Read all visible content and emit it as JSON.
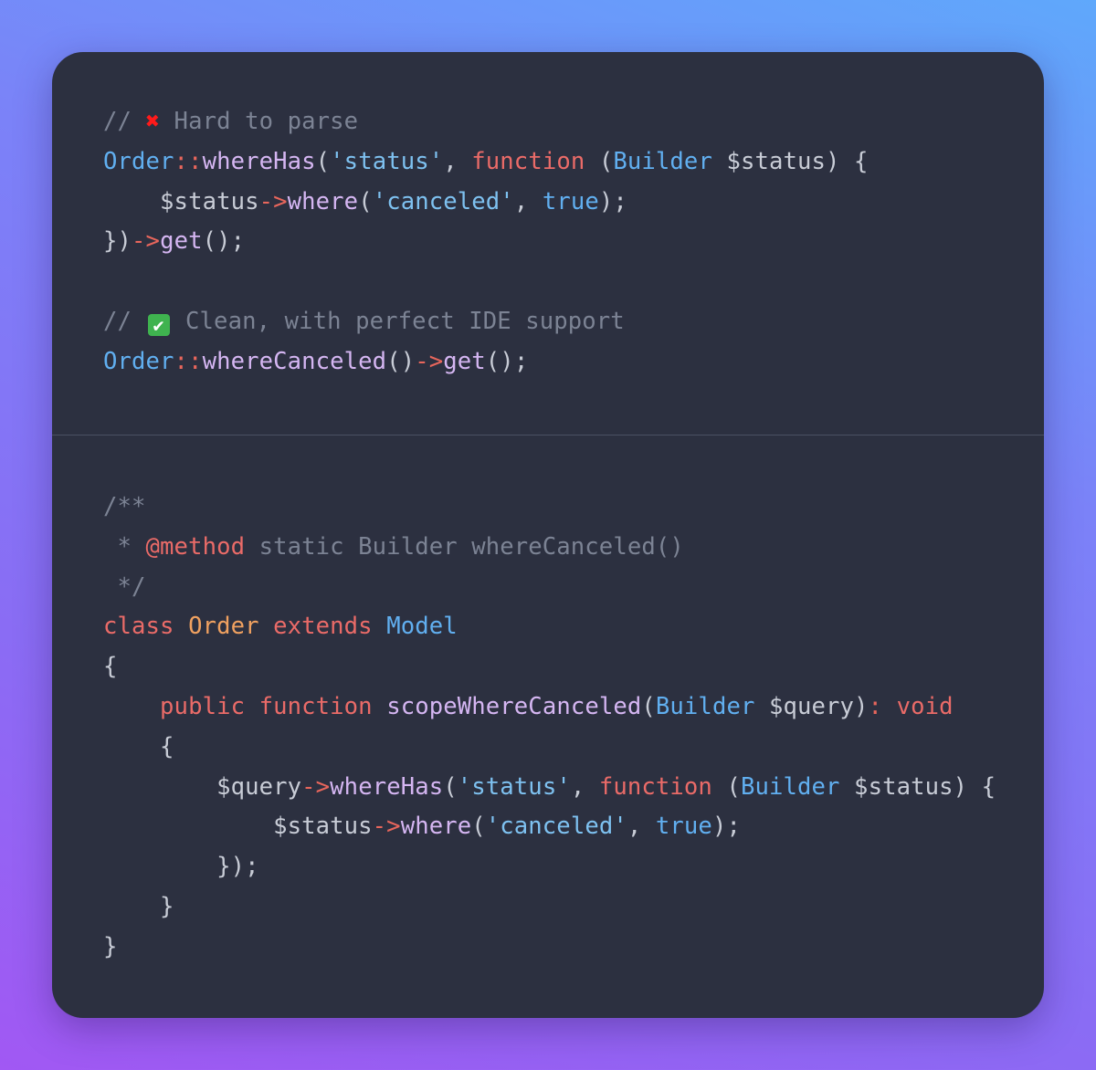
{
  "colors": {
    "card_background": "#2c3040",
    "comment": "#7c8394",
    "class_name": "#61aff0",
    "operator": "#e8665c",
    "method": "#d5b6f2",
    "string": "#7ec1f0",
    "keyword": "#ea6b68",
    "type_name": "#f0a160",
    "default_text": "#c8ccd6"
  },
  "top": {
    "comment_bad": {
      "prefix": "// ",
      "icon": "cross-mark-icon",
      "icon_glyph": "✖",
      "text": " Hard to parse"
    },
    "line1": {
      "class": "Order",
      "op": "::",
      "method": "whereHas",
      "open": "(",
      "arg1": "'status'",
      "comma": ", ",
      "kw": "function",
      "sp": " (",
      "type": "Builder",
      "var": " $status",
      "close": ") {"
    },
    "line2": {
      "indent": "    ",
      "var": "$status",
      "op": "->",
      "method": "where",
      "open": "(",
      "str": "'canceled'",
      "comma": ", ",
      "bool": "true",
      "close": ");"
    },
    "line3": {
      "close": "})",
      "op": "->",
      "method": "get",
      "end": "();"
    },
    "comment_good": {
      "prefix": "// ",
      "icon": "check-mark-icon",
      "icon_glyph": "✔",
      "text": " Clean, with perfect IDE support"
    },
    "line4": {
      "class": "Order",
      "op": "::",
      "method": "whereCanceled",
      "paren": "()",
      "op2": "->",
      "method2": "get",
      "end": "();"
    }
  },
  "bottom": {
    "doc_open": "/**",
    "doc_line": {
      "prefix": " * ",
      "tag": "@method",
      "text": " static Builder whereCanceled()"
    },
    "doc_close": " */",
    "class_line": {
      "kw": "class",
      "name": "Order",
      "kw2": "extends",
      "parent": "Model"
    },
    "brace_open": "{",
    "method_line": {
      "indent": "    ",
      "kw1": "public",
      "kw2": "function",
      "name": "scopeWhereCanceled",
      "open": "(",
      "type": "Builder",
      "var": " $query",
      "close": ")",
      "colon": ":",
      "ret": "void"
    },
    "method_brace_open": "    {",
    "query_line": {
      "indent": "        ",
      "var": "$query",
      "op": "->",
      "method": "whereHas",
      "open": "(",
      "str": "'status'",
      "comma": ", ",
      "kw": "function",
      "sp": " (",
      "type": "Builder",
      "var2": " $status",
      "close": ") {"
    },
    "status_line": {
      "indent": "            ",
      "var": "$status",
      "op": "->",
      "method": "where",
      "open": "(",
      "str": "'canceled'",
      "comma": ", ",
      "bool": "true",
      "close": ");"
    },
    "closure_close": "        });",
    "method_brace_close": "    }",
    "brace_close": "}"
  }
}
